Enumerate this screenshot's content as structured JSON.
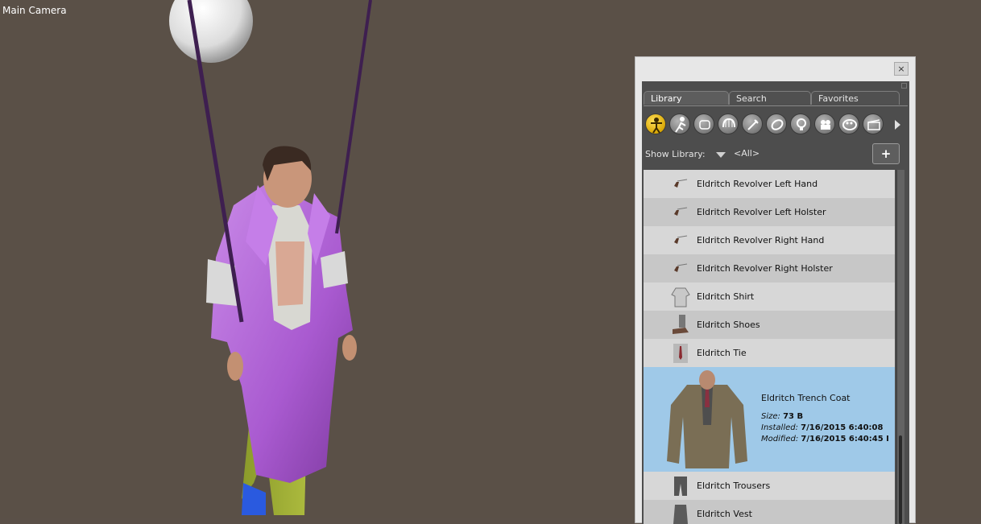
{
  "viewport": {
    "camera_label": "Main Camera"
  },
  "panel": {
    "close_label": "×",
    "tabs": [
      {
        "label": "Library",
        "active": true
      },
      {
        "label": "Search",
        "active": false
      },
      {
        "label": "Favorites",
        "active": false
      }
    ],
    "categories": [
      "figures-icon",
      "poses-icon",
      "expressions-icon",
      "hair-icon",
      "props-icon",
      "wardrobe-icon",
      "lights-icon",
      "cameras-icon",
      "materials-icon",
      "scenes-icon"
    ],
    "show_library_label": "Show Library:",
    "show_library_value": "<All>",
    "add_folder_label": "+",
    "items": [
      {
        "label": "Eldritch Revolver Left Hand",
        "icon": "revolver-icon"
      },
      {
        "label": "Eldritch Revolver Left Holster",
        "icon": "revolver-icon"
      },
      {
        "label": "Eldritch Revolver Right Hand",
        "icon": "revolver-icon"
      },
      {
        "label": "Eldritch Revolver Right Holster",
        "icon": "revolver-icon"
      },
      {
        "label": "Eldritch Shirt",
        "icon": "shirt-icon"
      },
      {
        "label": "Eldritch Shoes",
        "icon": "shoes-icon"
      },
      {
        "label": "Eldritch Tie",
        "icon": "tie-icon"
      }
    ],
    "selected": {
      "title": "Eldritch Trench Coat",
      "size_label": "Size:",
      "size_value": "73 B",
      "installed_label": "Installed:",
      "installed_value": "7/16/2015 6:40:08",
      "modified_label": "Modified:",
      "modified_value": "7/16/2015 6:40:45 I"
    },
    "items_after": [
      {
        "label": "Eldritch Trousers",
        "icon": "trousers-icon"
      },
      {
        "label": "Eldritch Vest",
        "icon": "vest-icon"
      }
    ]
  },
  "colors": {
    "viewport_bg": "#5a5047",
    "selected_row": "#9fc9e8",
    "coat": "#b060d0"
  }
}
